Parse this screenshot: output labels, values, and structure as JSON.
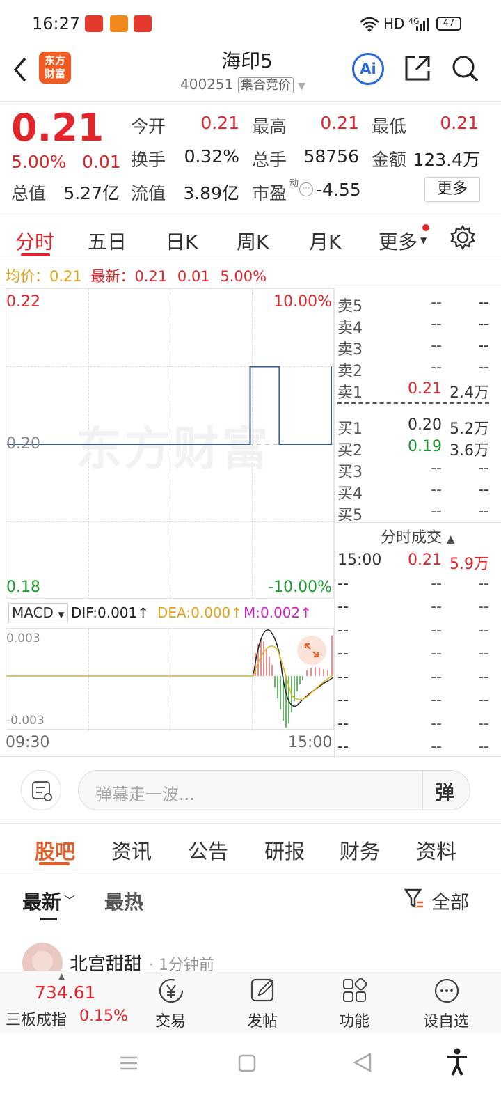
{
  "status": {
    "time": "16:27",
    "network": "HD",
    "signal": "4G",
    "battery": "47"
  },
  "header": {
    "logo_line1": "东方",
    "logo_line2": "财富",
    "stock_name": "海印5",
    "code": "400251",
    "auction_tag": "集合竞价",
    "ai": "Ai"
  },
  "quote": {
    "price": "0.21",
    "change_pct": "5.00%",
    "change": "0.01",
    "open_label": "今开",
    "open": "0.21",
    "high_label": "最高",
    "high": "0.21",
    "low_label": "最低",
    "low": "0.21",
    "turnover_label": "换手",
    "turnover": "0.32%",
    "volume_label": "总手",
    "volume": "58756",
    "amount_label": "金额",
    "amount": "123.4万",
    "mcap_label": "总值",
    "mcap": "5.27亿",
    "float_label": "流值",
    "float": "3.89亿",
    "pe_label": "市盈",
    "pe_sup": "动",
    "pe": "-4.55",
    "more": "更多"
  },
  "tabs": [
    "分时",
    "五日",
    "日K",
    "周K",
    "月K",
    "更多"
  ],
  "info_line": {
    "avg_label": "均价：",
    "avg": "0.21",
    "latest_label": "最新：",
    "latest": "0.21",
    "chg": "0.01",
    "pct": "5.00%"
  },
  "chart_data": {
    "type": "line",
    "x_start": "09:30",
    "x_end": "15:00",
    "ylim": [
      0.18,
      0.22
    ],
    "y_labels": {
      "top": "0.22",
      "mid": "0.20",
      "bottom": "0.18"
    },
    "pct_labels": {
      "top": "10.00%",
      "bottom": "-10.00%"
    },
    "series": [
      {
        "x": [
          0,
          0.74,
          0.75,
          0.83,
          0.84,
          0.99,
          1.0
        ],
        "values": [
          0.2,
          0.2,
          0.21,
          0.21,
          0.2,
          0.2,
          0.21
        ]
      }
    ],
    "watermark": "东方财富"
  },
  "macd": {
    "label": "MACD",
    "dif": "DIF:0.001↑",
    "dea": "DEA:0.000↑",
    "m": "M:0.002↑",
    "top": "0.003",
    "bottom": "-0.003"
  },
  "orderbook": {
    "asks": [
      {
        "label": "卖5",
        "price": "--",
        "vol": "--"
      },
      {
        "label": "卖4",
        "price": "--",
        "vol": "--"
      },
      {
        "label": "卖3",
        "price": "--",
        "vol": "--"
      },
      {
        "label": "卖2",
        "price": "--",
        "vol": "--"
      },
      {
        "label": "卖1",
        "price": "0.21",
        "vol": "2.4万"
      }
    ],
    "bids": [
      {
        "label": "买1",
        "price": "0.20",
        "vol": "5.2万"
      },
      {
        "label": "买2",
        "price": "0.19",
        "vol": "3.6万"
      },
      {
        "label": "买3",
        "price": "--",
        "vol": "--"
      },
      {
        "label": "买4",
        "price": "--",
        "vol": "--"
      },
      {
        "label": "买5",
        "price": "--",
        "vol": "--"
      }
    ]
  },
  "trades": {
    "title": "分时成交",
    "rows": [
      {
        "time": "15:00",
        "price": "0.21",
        "vol": "5.9万"
      },
      {
        "time": "--",
        "price": "--",
        "vol": "--"
      },
      {
        "time": "--",
        "price": "--",
        "vol": "--"
      },
      {
        "time": "--",
        "price": "--",
        "vol": "--"
      },
      {
        "time": "--",
        "price": "--",
        "vol": "--"
      },
      {
        "time": "--",
        "price": "--",
        "vol": "--"
      },
      {
        "time": "--",
        "price": "--",
        "vol": "--"
      },
      {
        "time": "--",
        "price": "--",
        "vol": "--"
      },
      {
        "time": "--",
        "price": "--",
        "vol": "--"
      }
    ]
  },
  "danmu": {
    "placeholder": "弹幕走一波...",
    "btn": "弹"
  },
  "section_tabs": [
    "股吧",
    "资讯",
    "公告",
    "研报",
    "财务",
    "资料"
  ],
  "sort": {
    "latest": "最新",
    "hot": "最热",
    "filter": "全部"
  },
  "post": {
    "user": "北宫甜甜",
    "time": "· 1分钟前"
  },
  "bottom": {
    "index_value": "734.61",
    "index_name": "三板成指",
    "index_pct": "0.15%",
    "trade": "交易",
    "post": "发帖",
    "func": "功能",
    "watch": "设自选"
  },
  "colors": {
    "red": "#e0252b",
    "green": "#1a9a2c",
    "line": "#3d5a80",
    "orange": "#f05a23"
  }
}
